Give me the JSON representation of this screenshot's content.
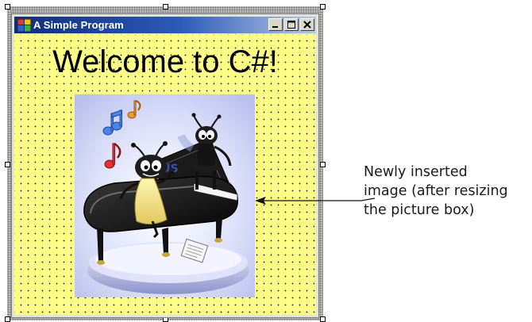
{
  "window": {
    "title": "A Simple Program",
    "buttons": [
      "minimize",
      "maximize",
      "close"
    ]
  },
  "form": {
    "label_text": "Welcome to C#!",
    "background_color": "#ffff88"
  },
  "picture_box": {
    "description_icon": "piano-bugs-clipart"
  },
  "callout": {
    "line1": "Newly inserted",
    "line2": "image (after resizing",
    "line3": "the picture box)"
  }
}
